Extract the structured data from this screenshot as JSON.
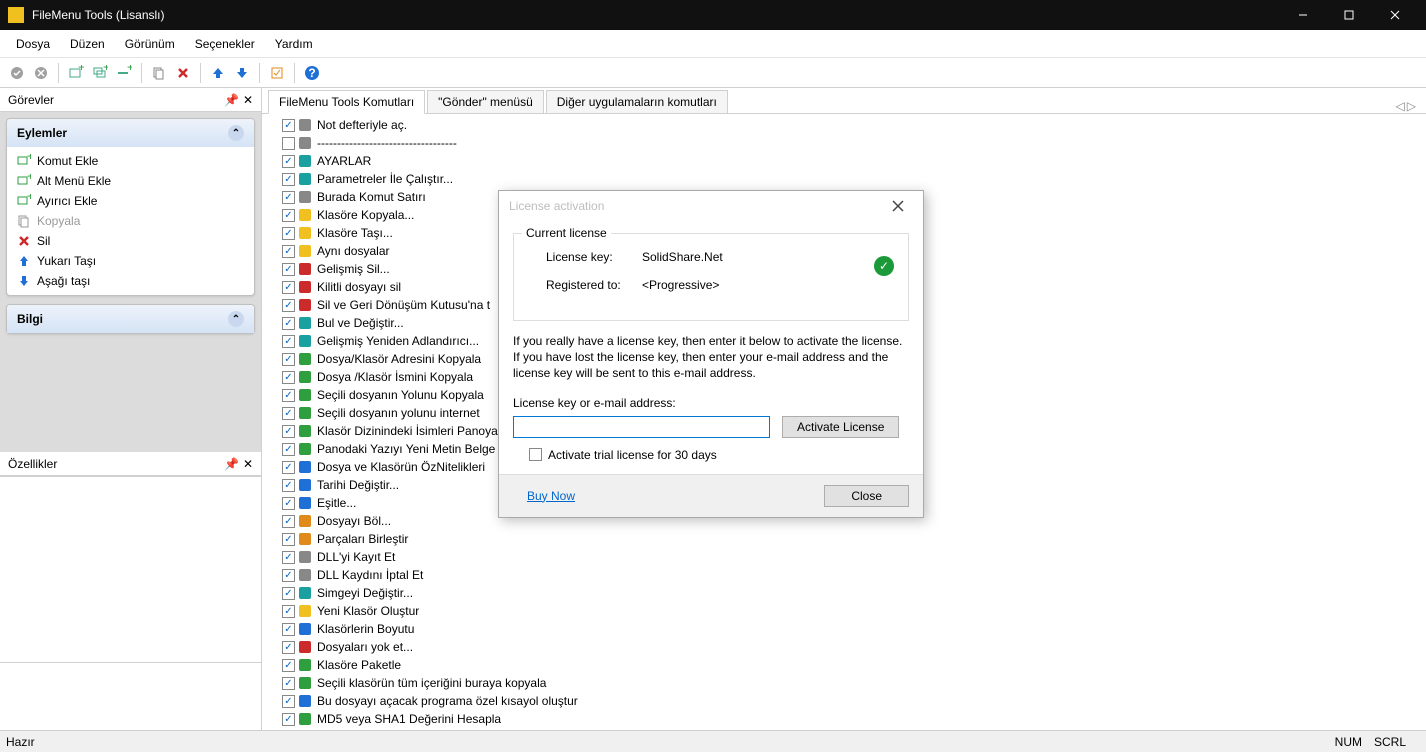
{
  "titlebar": {
    "title": "FileMenu Tools (Lisanslı)"
  },
  "menu": {
    "items": [
      "Dosya",
      "Düzen",
      "Görünüm",
      "Seçenekler",
      "Yardım"
    ]
  },
  "panels": {
    "tasks_title": "Görevler",
    "properties_title": "Özellikler",
    "actions_group": "Eylemler",
    "info_group": "Bilgi",
    "actions": [
      {
        "label": "Komut Ekle",
        "icon": "green",
        "disabled": false
      },
      {
        "label": "Alt Menü Ekle",
        "icon": "green",
        "disabled": false
      },
      {
        "label": "Ayırıcı Ekle",
        "icon": "green",
        "disabled": false
      },
      {
        "label": "Kopyala",
        "icon": "gray",
        "disabled": true
      },
      {
        "label": "Sil",
        "icon": "red",
        "disabled": false
      },
      {
        "label": "Yukarı Taşı",
        "icon": "blue",
        "disabled": false
      },
      {
        "label": "Aşağı taşı",
        "icon": "blue",
        "disabled": false
      }
    ]
  },
  "tabs": {
    "items": [
      "FileMenu Tools Komutları",
      "\"Gönder\" menüsü",
      "Diğer uygulamaların komutları"
    ],
    "active": 0
  },
  "tree": {
    "items": [
      {
        "checked": true,
        "label": "Not defteriyle aç.",
        "color": "gray"
      },
      {
        "checked": false,
        "label": "-----------------------------------",
        "color": "gray"
      },
      {
        "checked": true,
        "label": "AYARLAR",
        "color": "teal"
      },
      {
        "checked": true,
        "label": "Parametreler İle Çalıştır...",
        "color": "teal"
      },
      {
        "checked": true,
        "label": "Burada Komut Satırı",
        "color": "gray"
      },
      {
        "checked": true,
        "label": "Klasöre Kopyala...",
        "color": "yellow"
      },
      {
        "checked": true,
        "label": "Klasöre Taşı...",
        "color": "yellow"
      },
      {
        "checked": true,
        "label": "Aynı dosyalar",
        "color": "yellow"
      },
      {
        "checked": true,
        "label": "Gelişmiş Sil...",
        "color": "red"
      },
      {
        "checked": true,
        "label": "Kilitli dosyayı sil",
        "color": "red"
      },
      {
        "checked": true,
        "label": "Sil ve Geri Dönüşüm Kutusu'na t",
        "color": "red"
      },
      {
        "checked": true,
        "label": "Bul ve Değiştir...",
        "color": "teal"
      },
      {
        "checked": true,
        "label": "Gelişmiş Yeniden Adlandırıcı...",
        "color": "teal"
      },
      {
        "checked": true,
        "label": "Dosya/Klasör Adresini Kopyala",
        "color": "green"
      },
      {
        "checked": true,
        "label": "Dosya /Klasör İsmini Kopyala",
        "color": "green"
      },
      {
        "checked": true,
        "label": "Seçili dosyanın  Yolunu Kopyala",
        "color": "green"
      },
      {
        "checked": true,
        "label": "Seçili dosyanın  yolunu internet",
        "color": "green"
      },
      {
        "checked": true,
        "label": "Klasör Dizinindeki İsimleri Panoya",
        "color": "green"
      },
      {
        "checked": true,
        "label": " Panodaki Yazıyı Yeni Metin Belge",
        "color": "green"
      },
      {
        "checked": true,
        "label": "Dosya ve Klasörün ÖzNitelikleri",
        "color": "blue"
      },
      {
        "checked": true,
        "label": "Tarihi Değiştir...",
        "color": "blue"
      },
      {
        "checked": true,
        "label": "Eşitle...",
        "color": "blue"
      },
      {
        "checked": true,
        "label": "Dosyayı Böl...",
        "color": "orange"
      },
      {
        "checked": true,
        "label": "Parçaları Birleştir",
        "color": "orange"
      },
      {
        "checked": true,
        "label": "DLL'yi Kayıt Et",
        "color": "gray"
      },
      {
        "checked": true,
        "label": "DLL Kaydını İptal Et",
        "color": "gray"
      },
      {
        "checked": true,
        "label": "Simgeyi Değiştir...",
        "color": "teal"
      },
      {
        "checked": true,
        "label": "Yeni Klasör Oluştur",
        "color": "yellow"
      },
      {
        "checked": true,
        "label": "Klasörlerin Boyutu",
        "color": "blue"
      },
      {
        "checked": true,
        "label": "Dosyaları yok et...",
        "color": "red"
      },
      {
        "checked": true,
        "label": "Klasöre Paketle",
        "color": "green"
      },
      {
        "checked": true,
        "label": "Seçili klasörün tüm içeriğini buraya kopyala",
        "color": "green"
      },
      {
        "checked": true,
        "label": "Bu dosyayı açacak programa özel kısayol oluştur",
        "color": "blue"
      },
      {
        "checked": true,
        "label": "MD5 veya SHA1 Değerini Hesapla",
        "color": "green"
      }
    ]
  },
  "dialog": {
    "title": "License activation",
    "legend": "Current license",
    "key_label": "License key:",
    "key_value": "SolidShare.Net",
    "reg_label": "Registered to:",
    "reg_value": "<Progressive>",
    "help_text": "If you really have a license key, then enter it below to activate the license. If you have lost the license key, then enter your e-mail address and the license key will be sent to this e-mail address.",
    "input_label": "License key or e-mail address:",
    "input_value": "",
    "activate_btn": "Activate License",
    "trial_label": "Activate trial license for 30 days",
    "buy_link": "Buy Now",
    "close_btn": "Close"
  },
  "status": {
    "left": "Hazır",
    "num": "NUM",
    "scrl": "SCRL"
  }
}
